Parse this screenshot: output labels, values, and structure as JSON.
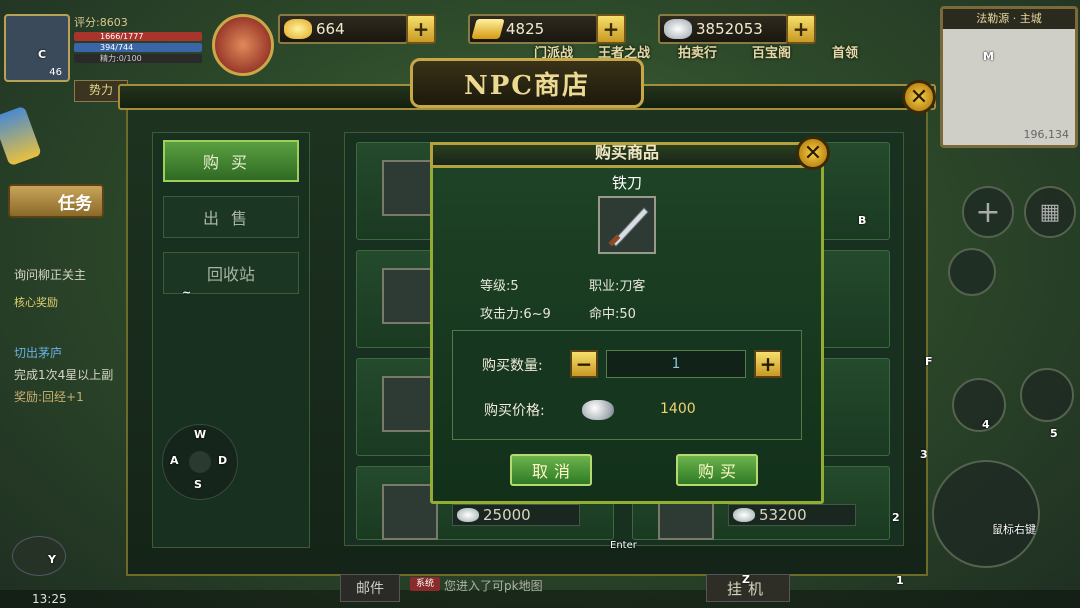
{
  "hud": {
    "player_level": "46",
    "score_label": "评分:8603",
    "hp_text": "1666/1777",
    "mp_text": "394/744",
    "energy_text": "精力:0/100",
    "faction_label": "势力",
    "currencies": [
      {
        "name": "gold-ingot",
        "value": "664",
        "color": "#f2c22e"
      },
      {
        "name": "gold-bar",
        "value": "4825",
        "color": "#e8b01c"
      },
      {
        "name": "silver-ingot",
        "value": "3852053",
        "color": "#c8d0d8"
      }
    ],
    "top_menu": [
      "门派战",
      "王者之战",
      "拍卖行",
      "百宝阁",
      "首领"
    ],
    "minimap_title": "法勒源 · 主城",
    "minimap_coords": "196,134",
    "time": "13:25"
  },
  "left_hud": {
    "quest_tab": "任务",
    "quest_lines": [
      "询问柳正关主",
      "核心奖励",
      "切出茅庐",
      "完成1次4星以上副",
      "奖励:回经+1"
    ]
  },
  "shop": {
    "title": "NPC商店",
    "side_buttons": {
      "buy": "购买",
      "sell": "出售",
      "recycle": "回收站"
    },
    "visible_prices": [
      "25000",
      "53200"
    ]
  },
  "dialog": {
    "title": "购买商品",
    "item_name": "铁刀",
    "level": "等级:5",
    "job": "职业:刀客",
    "attack": "攻击力:6~9",
    "hit": "命中:50",
    "qty_label": "购买数量:",
    "qty_value": "1",
    "price_label": "购买价格:",
    "price_value": "1400",
    "cancel": "取消",
    "confirm": "购买"
  },
  "bottom": {
    "mail": "邮件",
    "sys_badge": "系统",
    "message": "您进入了可pk地图",
    "hangup": "挂机"
  },
  "keys": {
    "c": "C",
    "m": "M",
    "b": "B",
    "f": "F",
    "n4": "4",
    "n5": "5",
    "n3": "3",
    "n2": "2",
    "n1": "1",
    "y": "Y",
    "z": "Z",
    "enter": "Enter",
    "tilde": "~",
    "w": "W",
    "a": "A",
    "s": "S",
    "d": "D",
    "mouse_right": "鼠标右键"
  }
}
